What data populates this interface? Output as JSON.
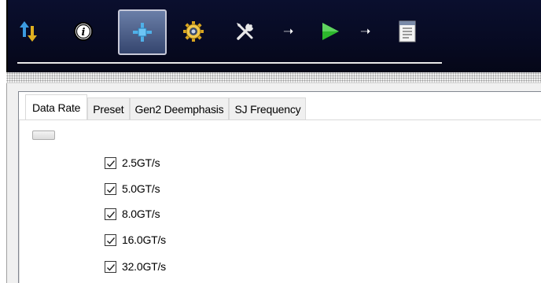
{
  "toolbar": {
    "icons": [
      "updown-arrows-icon",
      "info-icon",
      "move-crosshair-icon",
      "gear-icon",
      "tools-icon",
      "arrow-right-icon",
      "play-icon",
      "arrow-right-icon",
      "document-icon"
    ],
    "selected": "move-crosshair-icon"
  },
  "tabs": {
    "items": [
      "Data Rate",
      "Preset",
      "Gen2 Deemphasis",
      "SJ Frequency"
    ],
    "active": "Data Rate"
  },
  "data_rate": {
    "options": [
      {
        "label": "2.5GT/s",
        "checked": true
      },
      {
        "label": "5.0GT/s",
        "checked": true
      },
      {
        "label": "8.0GT/s",
        "checked": true
      },
      {
        "label": "16.0GT/s",
        "checked": true
      },
      {
        "label": "32.0GT/s",
        "checked": true
      }
    ]
  },
  "colors": {
    "toolbar_bg": "#070a22",
    "play_green": "#2db82d",
    "gear_gold": "#d9a520"
  }
}
